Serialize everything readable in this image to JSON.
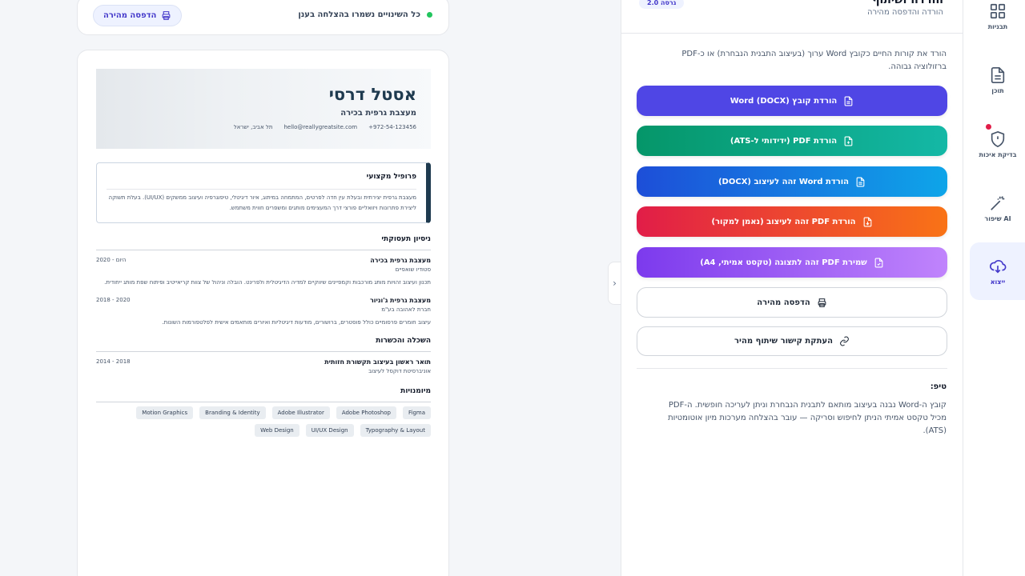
{
  "topbar": {
    "saved_text": "כל השינויים נשמרו בהצלחה בענן",
    "print_label": "הדפסה מהירה"
  },
  "resume": {
    "name": "אסטל דרסי",
    "role": "מעצבת גרפית בכירה",
    "contact": [
      "+972-54-123456",
      "hello@reallygreatsite.com",
      "תל אביב, ישראל"
    ],
    "profile": {
      "title": "פרופיל מקצועי",
      "text": "מעצבת גרפית יצירתית ובעלת עין חדה לפרטים, המתמחה במיתוג, איור דיגיטלי, טיפוגרפיה ועיצוב ממשקים (UI/UX). בעלת תשוקה ליצירת פתרונות ויזואליים פורצי דרך המעצימים מותגים ומשפרים חווית משתמש."
    },
    "experience": {
      "title": "ניסיון תעסוקתי",
      "jobs": [
        {
          "title": "מעצבת גרפית בכירה",
          "company": "סטודיו שואפיים",
          "date": "2020 - היום",
          "desc": "תכנון ועיצוב זהויות מותג מורכבות וקמפיינים שיווקיים למדיה הדיגיטלית ולפרינט. הובלה וניהול של צוות קריאייטיב ופיתוח שפת מותג ייחודית."
        },
        {
          "title": "מעצבת גרפית ג'וניור",
          "company": "חברת לאהובה בע\"מ",
          "date": "2018 - 2020",
          "desc": "עיצוב חומרים פרסומיים כולל פוסטרים, ברושורים, מודעות דיגיטליות ואיורים מותאמים אישית לפלטפורמות השונות."
        }
      ]
    },
    "education": {
      "title": "השכלה והכשרות",
      "items": [
        {
          "title": "תואר ראשון בעיצוב תקשורת חזותית",
          "school": "אוניברסיטת דוקסל לעיצוב",
          "date": "2014 - 2018"
        }
      ]
    },
    "skills": {
      "title": "מיומנויות",
      "items": [
        "Figma",
        "Adobe Photoshop",
        "Adobe Illustrator",
        "Branding & Identity",
        "Motion Graphics",
        "Typography & Layout",
        "UI/UX Design",
        "Web Design"
      ]
    }
  },
  "panel": {
    "title": "הורדה ושיתוף",
    "subtitle": "הורדה והדפסה מהירה",
    "version": "גרסה 2.0",
    "intro": "הורד את קורות החיים כקובץ Word ערוך (בעיצוב התבנית הנבחרת) או כ-PDF ברזולוציה גבוהה.",
    "buttons": [
      "הורדת קובץ Word (DOCX)",
      "הורדת PDF (ידידותי ל-ATS)",
      "הורדת Word זהה לעיצוב (DOCX)",
      "הורדת PDF זהה לעיצוב (נאמן למקור)",
      "שמירת PDF זהה לתצוגה (טקסט אמיתי, A4)",
      "הדפסה מהירה",
      "העתקת קישור שיתוף מהיר"
    ],
    "tip_title": "טיפ:",
    "tip_text": "קובץ ה-Word נבנה בעיצוב מותאם לתבנית הנבחרת וניתן לעריכה חופשית. ה-PDF מכיל טקסט אמיתי הניתן לחיפוש וסריקה — עובר בהצלחה מערכות מיון אוטומטיות (ATS)."
  },
  "rail": {
    "items": [
      "תבניות",
      "תוכן",
      "בדיקת איכות",
      "שיפור AI",
      "ייצוא"
    ]
  },
  "colors": {
    "accent": "#4f46e5",
    "resume_dark": "#1e3a4f",
    "success_dot": "#22c55e",
    "alert_dot": "#e11d48"
  }
}
